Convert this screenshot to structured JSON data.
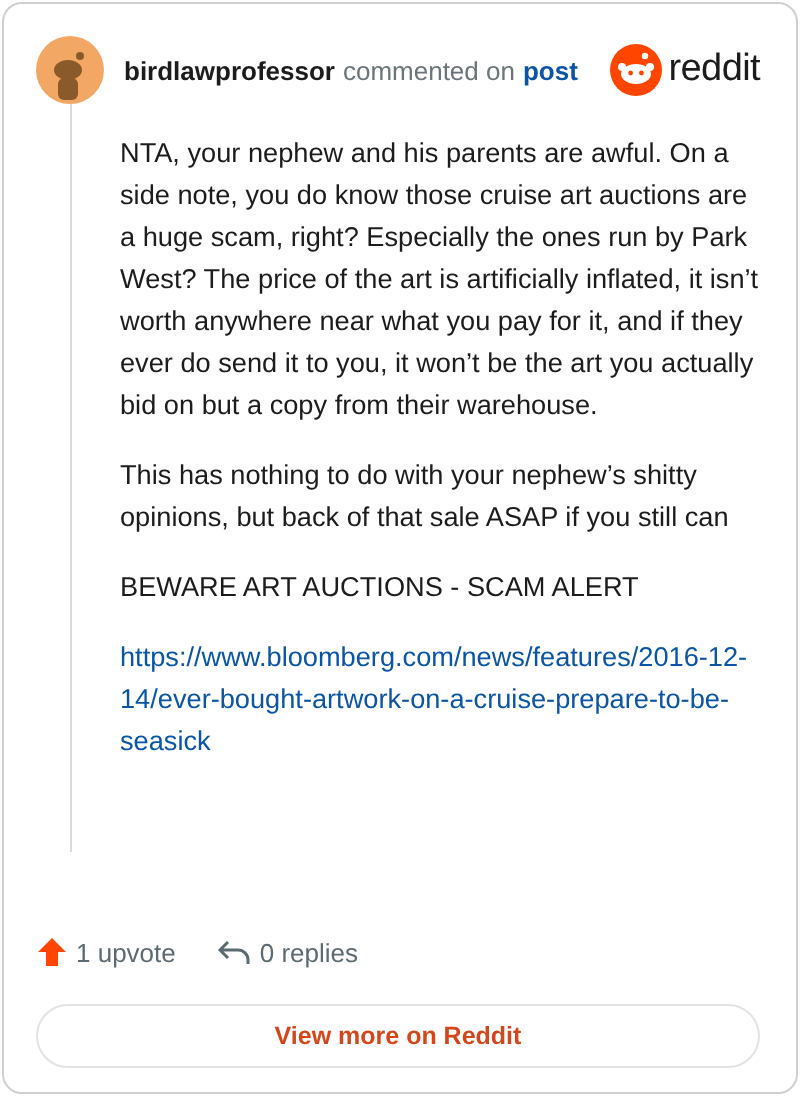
{
  "header": {
    "username": "birdlawprofessor",
    "action": "commented on",
    "post_link": "post",
    "brand": "reddit"
  },
  "body": [
    {
      "kind": "paragraph",
      "text": "NTA, your nephew and his parents are awful. On a side note, you do know those cruise art auctions are a huge scam, right? Especially the ones run by Park West? The price of the art is artificially inflated, it isn’t worth anywhere near what you pay for it, and if they ever do send it to you, it won’t be the art you actually bid on but a copy from their warehouse."
    },
    {
      "kind": "paragraph",
      "text": "This has nothing to do with your nephew’s shitty opinions, but back of that sale ASAP if you still can"
    },
    {
      "kind": "paragraph",
      "text": "BEWARE ART AUCTIONS - SCAM ALERT"
    },
    {
      "kind": "link",
      "text": "https://www.bloomberg.com/news/features/2016-12-14/ever-bought-artwork-on-a-cruise-prepare-to-be-seasick"
    }
  ],
  "footer": {
    "upvotes": "1 upvote",
    "upvoted": true,
    "replies": "0 replies",
    "button": "View more on Reddit"
  }
}
